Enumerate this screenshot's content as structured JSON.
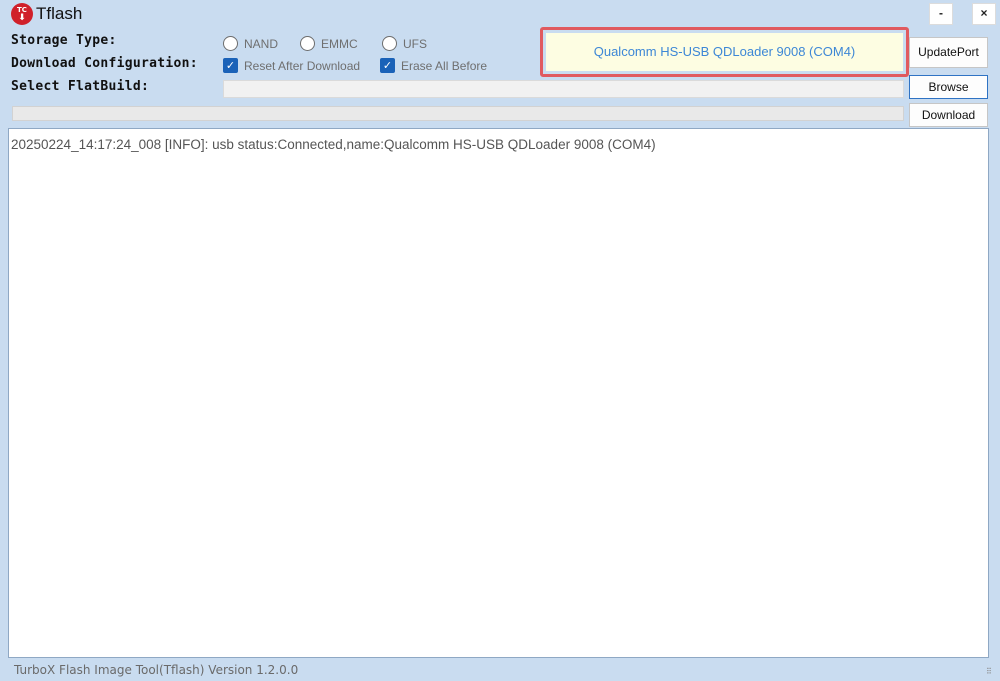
{
  "window": {
    "title": "Tflash",
    "logo_text": "TC",
    "minimize_label": "-",
    "close_label": "×"
  },
  "labels": {
    "storage_type": "Storage Type:",
    "download_configuration": "Download Configuration:",
    "select_flatbuild": "Select FlatBuild:"
  },
  "storage_type_options": [
    {
      "label": "NAND",
      "selected": false
    },
    {
      "label": "EMMC",
      "selected": false
    },
    {
      "label": "UFS",
      "selected": false
    }
  ],
  "download_configuration_options": [
    {
      "label": "Reset After Download",
      "checked": true
    },
    {
      "label": "Erase All Before",
      "checked": true
    }
  ],
  "port_display": {
    "text": "Qualcomm HS-USB QDLoader 9008 (COM4)"
  },
  "buttons": {
    "update_port": "UpdatePort",
    "browse": "Browse",
    "download": "Download"
  },
  "flatbuild_path": {
    "value": ""
  },
  "progress": {
    "fraction": 0
  },
  "log": {
    "lines": [
      "20250224_14:17:24_008 [INFO]: usb status:Connected,name:Qualcomm HS-USB QDLoader 9008 (COM4)"
    ]
  },
  "status_bar": {
    "text": "TurboX Flash Image Tool(Tflash) Version 1.2.0.0"
  },
  "colors": {
    "window_background": "#c9dcf0",
    "port_highlight_border": "#e05a5f",
    "port_text": "#3d87d6",
    "checkbox_checked": "#1a62b8"
  },
  "icons": {
    "logo": "tc-logo-icon",
    "checkmark": "checkmark-icon",
    "resize": "resize-grip-icon"
  }
}
